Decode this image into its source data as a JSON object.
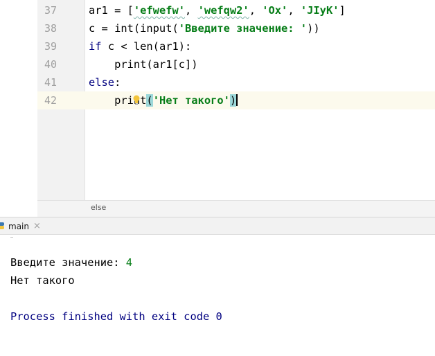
{
  "editor": {
    "lines": [
      {
        "number": "37",
        "tokens": [
          {
            "text": "ar1 = [",
            "type": "plain"
          },
          {
            "text": "'efwefw'",
            "type": "string-typo"
          },
          {
            "text": ", ",
            "type": "plain"
          },
          {
            "text": "'wefqw2'",
            "type": "string-typo"
          },
          {
            "text": ", ",
            "type": "plain"
          },
          {
            "text": "'Ox'",
            "type": "string"
          },
          {
            "text": ", ",
            "type": "plain"
          },
          {
            "text": "'JIyK'",
            "type": "string"
          },
          {
            "text": "]",
            "type": "plain"
          }
        ]
      },
      {
        "number": "38",
        "tokens": [
          {
            "text": "c = int(input(",
            "type": "plain"
          },
          {
            "text": "'Введите значение: '",
            "type": "string"
          },
          {
            "text": "))",
            "type": "plain"
          }
        ]
      },
      {
        "number": "39",
        "tokens": [
          {
            "text": "if",
            "type": "keyword"
          },
          {
            "text": " c < len(ar1):",
            "type": "plain"
          }
        ]
      },
      {
        "number": "40",
        "tokens": [
          {
            "text": "    print(ar1[c])",
            "type": "plain"
          }
        ]
      },
      {
        "number": "41",
        "tokens": [
          {
            "text": "else",
            "type": "keyword"
          },
          {
            "text": ":",
            "type": "plain"
          }
        ]
      },
      {
        "number": "42",
        "tokens": [
          {
            "text": "    print",
            "type": "plain"
          },
          {
            "text": "(",
            "type": "brace-match"
          },
          {
            "text": "'Нет такого'",
            "type": "string"
          },
          {
            "text": ")",
            "type": "brace-match"
          },
          {
            "text": "",
            "type": "caret"
          }
        ]
      }
    ],
    "current_line_index": 5,
    "breadcrumb": "else"
  },
  "run": {
    "tab_label": "main",
    "tab_close": "×",
    "console_lines": [
      {
        "prompt": "Введите значение: ",
        "input": "4",
        "type": "prompt"
      },
      {
        "text": "Нет такого",
        "type": "output"
      },
      {
        "text": "",
        "type": "blank"
      },
      {
        "text": "Process finished with exit code 0",
        "type": "exit"
      }
    ]
  },
  "colors": {
    "keyword": "#000080",
    "string": "#067d17",
    "current_line": "#fcfaed",
    "brace_match": "#9cd8d9",
    "gutter": "#f2f2f2"
  },
  "icons": {
    "intention": "lightbulb-icon",
    "run_tab": "python-run-icon"
  }
}
